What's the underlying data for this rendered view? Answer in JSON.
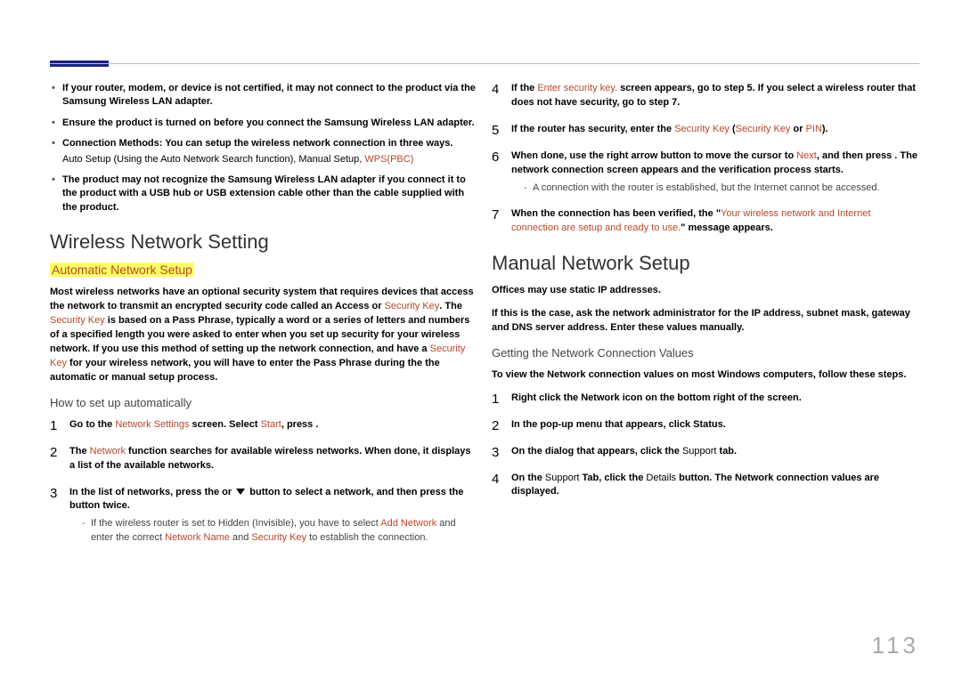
{
  "left": {
    "notes": [
      {
        "pre": "If your router, modem, or device is not certified, it may not connect to the product via the ",
        "mid": "Samsung Wireless LAN adapter",
        "post": "."
      },
      {
        "pre": "Ensure the product is turned on before you connect the ",
        "mid": "Samsung Wireless LAN adapter",
        "post": "."
      },
      {
        "pre": "Connection Methods: You can setup the wireless network connection in three ways.",
        "sub_pre": "Auto Setup (Using the Auto Network Search function), Manual Setup, ",
        "sub_red": "WPS(PBC)"
      },
      {
        "pre": "The product may not recognize the ",
        "mid": "Samsung Wireless LAN adapter",
        "post": " if you connect it to the product with a USB hub or USB extension cable other than the cable supplied with the product."
      }
    ],
    "h2": "Wireless Network Setting",
    "h3": "Automatic Network Setup",
    "para_parts": {
      "p1": "Most wireless networks have an optional security system that requires devices that access the network to transmit an encrypted security code called an Access or ",
      "sk1": "Security Key",
      "p2": ". The ",
      "sk2": "Security Key",
      "p3": " is based on a Pass Phrase, typically a word or a series of letters and numbers of a specified length you were asked to enter when you set up security for your wireless network. If you use this method of setting up the network connection, and have a ",
      "sk3": "Security Key",
      "p4": " for your wireless network, you will have to enter the Pass Phrase during the the automatic or manual setup process."
    },
    "h4": "How to set up automatically",
    "steps": {
      "s1a": "Go to the ",
      "s1r1": "Network Settings",
      "s1b": " screen. Select ",
      "s1r2": "Start",
      "s1c": ", press .",
      "s2a": "The ",
      "s2r1": "Network",
      "s2b": " function searches for available wireless networks. When done, it displays a list of the available networks.",
      "s3a": "In the list of networks, press the  or ",
      "s3b": " button to select a network, and then press the  button twice.",
      "s3_sub_a": "If the wireless router is set to Hidden (Invisible), you have to select ",
      "s3_sub_r1": "Add Network",
      "s3_sub_b": " and enter the correct ",
      "s3_sub_r2": "Network Name",
      "s3_sub_c": " and ",
      "s3_sub_r3": "Security Key",
      "s3_sub_d": " to establish the connection."
    }
  },
  "right": {
    "steps_a": {
      "s4a": "If the ",
      "s4r": "Enter security key.",
      "s4b": " screen appears, go to step 5. If you select a wireless router that does not have security, go to step 7.",
      "s5a": "If the router has security, enter the ",
      "s5r1": "Security Key",
      "s5b": " (",
      "s5r2": "Security Key",
      "s5c": " or ",
      "s5r3": "PIN",
      "s5d": ").",
      "s6a": "When done, use the right arrow button to move the cursor to ",
      "s6r": "Next",
      "s6b": ", and then press . The network connection screen appears and the verification process starts.",
      "s6_sub": "A connection with the router is established, but the Internet cannot be accessed.",
      "s7a": "When the connection has been verified, the \"",
      "s7r": "Your wireless network and Internet connection are setup and ready to use.",
      "s7b": "\" message appears."
    },
    "h2": "Manual Network Setup",
    "para1": "Offices may use static IP addresses.",
    "para2": "If this is the case, ask the network administrator for the IP address, subnet mask, gateway and DNS server address. Enter these values manually.",
    "h4": "Getting the Network Connection Values",
    "para3": "To view the Network connection values on most Windows computers, follow these steps.",
    "steps_b": {
      "s1": "Right click the Network icon on the bottom right of the screen.",
      "s2": "In the pop-up menu that appears, click Status.",
      "s3a": "On the dialog that appears, click the ",
      "s3n": "Support",
      "s3b": " tab.",
      "s4a": "On the ",
      "s4n1": "Support",
      "s4b": " Tab, click the ",
      "s4n2": "Details",
      "s4c": " button. The Network connection values are displayed."
    }
  },
  "page": "113"
}
